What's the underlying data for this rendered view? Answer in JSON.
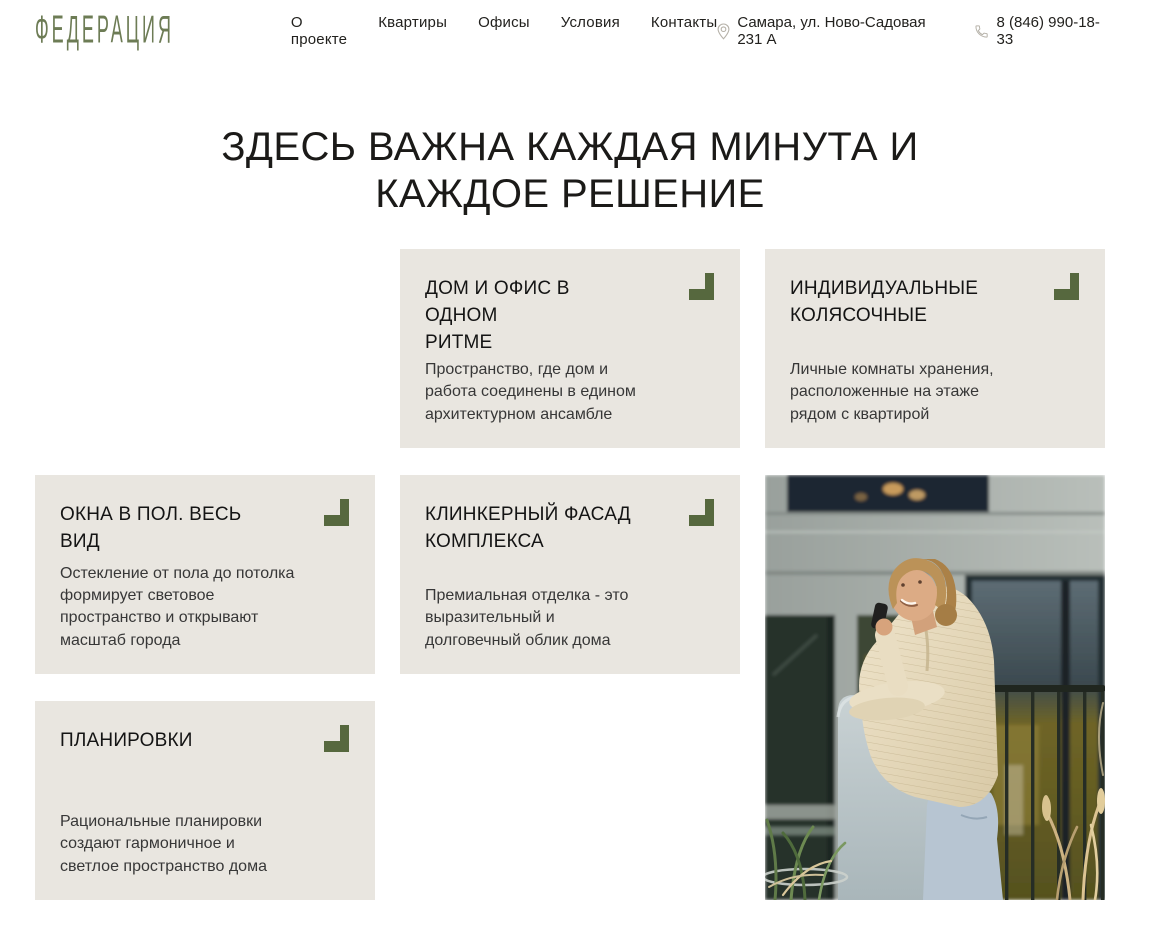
{
  "header": {
    "logo": "ФЕДЕРАЦИЯ",
    "nav": [
      {
        "label": "О проекте"
      },
      {
        "label": "Квартиры"
      },
      {
        "label": "Офисы"
      },
      {
        "label": "Условия"
      },
      {
        "label": "Контакты"
      }
    ],
    "address": "Самара, ул. Ново-Садовая 231 А",
    "phone": "8 (846) 990-18-33"
  },
  "hero": {
    "title": "ЗДЕСЬ ВАЖНА КАЖДАЯ МИНУТА И\nКАЖДОЕ РЕШЕНИЕ"
  },
  "features": {
    "cards": [
      {
        "title": "ДОМ И ОФИС В ОДНОМ\nРИТМЕ",
        "text": "Пространство, где дом и\nработа соединены в едином\nархитектурном ансамбле"
      },
      {
        "title": "ИНДИВИДУАЛЬНЫЕ\nКОЛЯСОЧНЫЕ",
        "text": "Личные комнаты хранения,\nрасположенные на этаже\nрядом с квартирой"
      },
      {
        "title": "ОКНА В ПОЛ. ВЕСЬ ВИД",
        "text": "Остекление от пола до потолка\nформирует световое\nпространство и открывают\nмасштаб города"
      },
      {
        "title": "КЛИНКЕРНЫЙ ФАСАД\nКОМПЛЕКСА",
        "text": "Премиальная отделка - это\nвыразительный и\nдолговечный облик дома"
      },
      {
        "title": "ПЛАНИРОВКИ",
        "text": "Рациональные планировки\nсоздают гармоничное и\nсветлое пространство дома"
      }
    ]
  },
  "icons": {
    "location": "location-pin-icon",
    "phone": "phone-icon",
    "card_corner": "corner-arrow-icon"
  },
  "colors": {
    "accent_green": "#56683e",
    "logo_green": "#6d7c55",
    "card_background": "#e9e6e0",
    "heading_text": "#1b1a18"
  }
}
